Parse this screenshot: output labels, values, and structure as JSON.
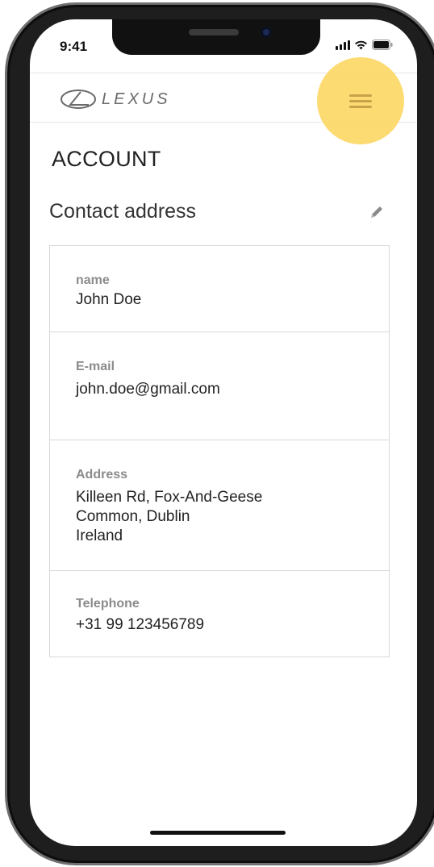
{
  "status_bar": {
    "time": "9:41"
  },
  "header": {
    "brand": "LEXUS",
    "menu_icon": "hamburger-menu-icon",
    "highlight_color": "#FDD660"
  },
  "page": {
    "title": "ACCOUNT"
  },
  "contact": {
    "section_title": "Contact address",
    "edit_icon": "pencil-icon",
    "fields": [
      {
        "label": "name",
        "value": "John Doe"
      },
      {
        "label": "E-mail",
        "value": "john.doe@gmail.com"
      },
      {
        "label": "Address",
        "value_lines": [
          "Killeen Rd, Fox-And-Geese",
          "Common, Dublin",
          "Ireland"
        ]
      },
      {
        "label": "Telephone",
        "value": "+31 99 123456789"
      }
    ]
  }
}
